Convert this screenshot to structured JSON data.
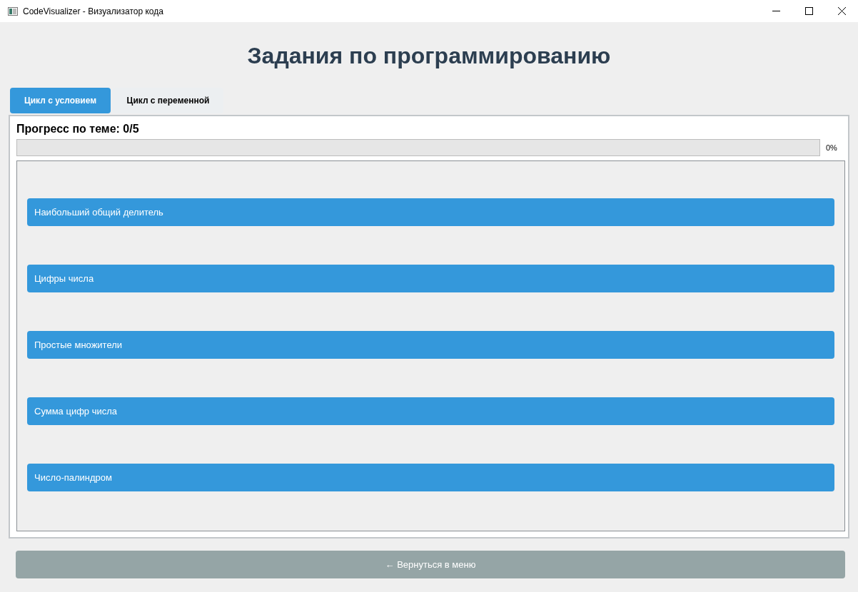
{
  "window": {
    "title": "CodeVisualizer - Визуализатор кода"
  },
  "heading": "Задания по программированию",
  "tabs": [
    {
      "label": "Цикл с условием",
      "selected": true
    },
    {
      "label": "Цикл с переменной",
      "selected": false
    }
  ],
  "progress": {
    "label": "Прогресс по теме: 0/5",
    "level": 0,
    "reading": "0%"
  },
  "tasks": [
    "Наибольший общий делитель",
    "Цифры числа",
    "Простые множители",
    "Сумма цифр числа",
    "Число-палиндром"
  ],
  "back_button": "← Вернуться в меню"
}
